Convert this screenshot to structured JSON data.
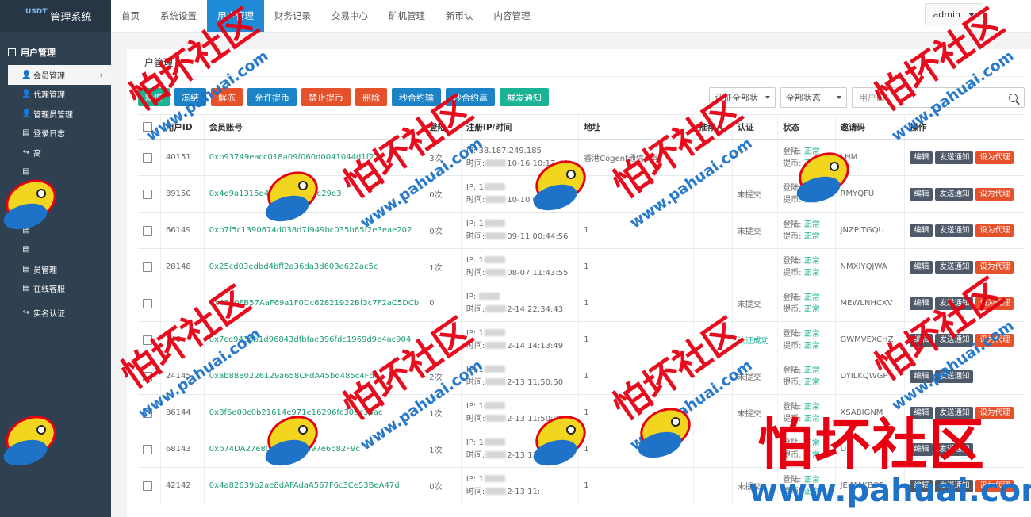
{
  "sidebar": {
    "logo_mark": "USDT",
    "logo_text": "管理系统",
    "group": "用户管理",
    "items": [
      {
        "label": "会员管理",
        "icon": "user-icon"
      },
      {
        "label": "代理管理",
        "icon": "user-icon"
      },
      {
        "label": "管理员管理",
        "icon": "user-icon"
      },
      {
        "label": "登录日志",
        "icon": "list-icon"
      },
      {
        "label": "高",
        "icon": "arrow-icon"
      },
      {
        "label": "",
        "icon": "list-icon"
      },
      {
        "label": "",
        "icon": "list-icon"
      },
      {
        "label": "",
        "icon": "list-icon"
      },
      {
        "label": "",
        "icon": "list-icon"
      },
      {
        "label": "",
        "icon": "list-icon"
      },
      {
        "label": "员管理",
        "icon": "list-icon"
      },
      {
        "label": "在线客服",
        "icon": "list-icon"
      },
      {
        "label": "实名认证",
        "icon": "arrow-icon"
      }
    ]
  },
  "topnav": {
    "tabs": [
      "首页",
      "系统设置",
      "用户管理",
      "财务记录",
      "交易中心",
      "矿机管理",
      "新币认",
      "内容管理"
    ],
    "user": "admin"
  },
  "panel": {
    "title": "户管理"
  },
  "toolbar": {
    "buttons": [
      {
        "label": "新增",
        "color": "green"
      },
      {
        "label": "冻结",
        "color": "blue"
      },
      {
        "label": "解冻",
        "color": "red"
      },
      {
        "label": "允许提币",
        "color": "blue"
      },
      {
        "label": "禁止提币",
        "color": "red"
      },
      {
        "label": "删除",
        "color": "red"
      },
      {
        "label": "秒合约输",
        "color": "blue"
      },
      {
        "label": "秒合约赢",
        "color": "blue"
      },
      {
        "label": "群发通知",
        "color": "green"
      }
    ]
  },
  "filters": {
    "auth_select": "认证全部状",
    "status_select": "全部状态",
    "userid_placeholder": "用户ID"
  },
  "table": {
    "headers": [
      "用户ID",
      "会员账号",
      "登陆",
      "注册IP/时间",
      "地址",
      "推荐人",
      "认证",
      "状态",
      "邀请码",
      "操作"
    ],
    "ip_prefix": "IP:",
    "time_prefix": "时间:",
    "login_label": "登陆:",
    "withdraw_label": "提币:",
    "normal": "正常",
    "actions": {
      "edit": "编辑",
      "notify": "发送通知",
      "agent": "设为代理"
    },
    "rows": [
      {
        "id": "40151",
        "account": "0xb93749eacc018a09f060d",
        "account_tail": "0041044",
        "account_end": "d1f27",
        "logins": "3次",
        "ip": "38.187.249.185",
        "time": "10-16 10:17:40",
        "address": "香港Cogent通信公司",
        "ref": "",
        "auth": "",
        "invite": "LHM",
        "agent": true
      },
      {
        "id": "89150",
        "account": "0x4e9a1315d40",
        "account_tail": "",
        "account_end": "8b7b1cd4fe29e3",
        "logins": "0次",
        "ip": "1",
        "time": "10-10 0",
        "address": "",
        "ref": "",
        "auth": "未提交",
        "invite": "RMYQFU",
        "agent": true
      },
      {
        "id": "66149",
        "account": "0xb7f5c1390674d038d7f949bc035b65f2e3eae202",
        "account_tail": "",
        "account_end": "",
        "logins": "0次",
        "ip": "1",
        "time": "09-11 00:44:56",
        "address": "1",
        "ref": "",
        "auth": "未提交",
        "invite": "JNZPITGQU",
        "agent": true
      },
      {
        "id": "28148",
        "account": "0x",
        "account_tail": "25cd03edbd4bff2a36da3d603e622ac5c",
        "account_end": "",
        "logins": "1次",
        "ip": "1",
        "time": "08-07 11:43:55",
        "address": "1",
        "ref": "",
        "auth": "",
        "invite": "NMXIYQJWA",
        "agent": true
      },
      {
        "id": "",
        "account": "0x4340FB57AaF69a1F0Dc62821922Bf3c7F2aC5DCb",
        "account_tail": "",
        "account_end": "",
        "logins": "0",
        "ip": "",
        "time": "2-14 22:34:43",
        "address": "1",
        "ref": "",
        "auth": "未提交",
        "invite": "MEWLNHCXV",
        "agent": true
      },
      {
        "id": "146",
        "account": "0x7ce9436b1d96843dfbfae396fdc1969d9e4ac904",
        "account_tail": "",
        "account_end": "",
        "logins": "",
        "ip": "1",
        "time": "2-14 14:13:49",
        "address": "1",
        "ref": "",
        "auth": "认证成功",
        "invite": "GWMVEXCHZ",
        "agent": true
      },
      {
        "id": "24145",
        "account": "0xab8880226129a658CFdA45bd485c4F",
        "account_tail": "",
        "account_end": "d6",
        "logins": "2次",
        "ip": "1",
        "time": "2-13 11:50:50",
        "address": "1",
        "ref": "",
        "auth": "未提交",
        "invite": "DYILKQWGP",
        "agent": false
      },
      {
        "id": "86144",
        "account": "0x8f6e00c0b21614e971e1629",
        "account_tail": "6fc309",
        "account_end": "c36ac",
        "logins": "1次",
        "ip": "1",
        "time": "2-13 11:50:06",
        "address": "1",
        "ref": "",
        "auth": "未提交",
        "invite": "XSABIGNM",
        "agent": true
      },
      {
        "id": "68143",
        "account": "0xb74DA27e80062",
        "account_tail": "",
        "account_end": "E608d97e6b82F9c",
        "logins": "1次",
        "ip": "1",
        "time": "2-13 11:",
        "address": "1",
        "ref": "",
        "auth": "",
        "invite": "D",
        "agent": false
      },
      {
        "id": "42142",
        "account": "0x4a82639b2ae8d",
        "account_tail": "AFAdaA567F6c3Ce53BeA47d",
        "account_end": "",
        "logins": "0次",
        "ip": "1",
        "time": "2-13 11:",
        "address": "1",
        "ref": "",
        "auth": "未提交",
        "invite": "JEIMAKBOR",
        "agent": true
      }
    ]
  },
  "watermark": {
    "brand": "怕坏社区",
    "url": "www.pahuai.com",
    "colors": {
      "red": "#e60012",
      "blue": "#1e73c8",
      "yellow": "#f2d51f"
    }
  }
}
